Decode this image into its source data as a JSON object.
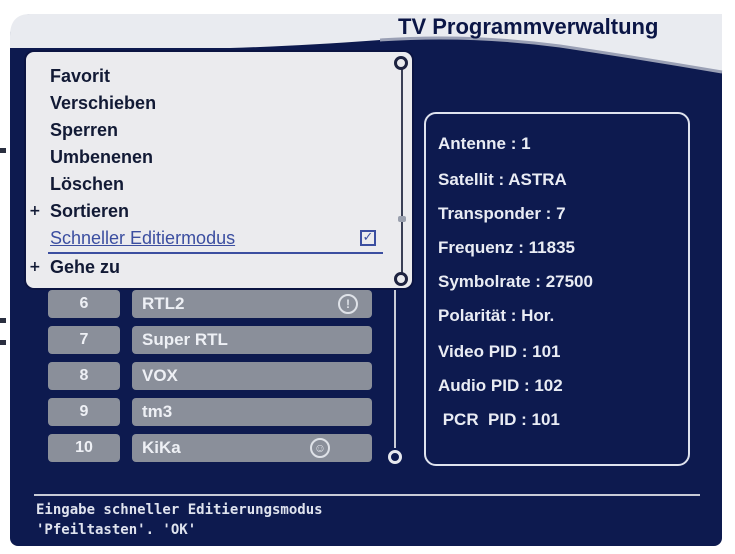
{
  "header": {
    "title": "TV Programmverwaltung"
  },
  "menu": {
    "items": [
      {
        "label": "Favorit",
        "plus": ""
      },
      {
        "label": "Verschieben",
        "plus": ""
      },
      {
        "label": "Sperren",
        "plus": ""
      },
      {
        "label": "Umbenenen",
        "plus": ""
      },
      {
        "label": "Löschen",
        "plus": ""
      },
      {
        "label": "Sortieren",
        "plus": "+"
      },
      {
        "label": "Schneller Editiermodus",
        "plus": "",
        "checked": true,
        "selected": true
      },
      {
        "label": "Gehe zu",
        "plus": "+"
      }
    ],
    "check_glyph": "✓"
  },
  "channels": [
    {
      "num": "6",
      "name": "RTL2",
      "badge": "!"
    },
    {
      "num": "7",
      "name": "Super RTL",
      "badge": ""
    },
    {
      "num": "8",
      "name": "VOX",
      "badge": ""
    },
    {
      "num": "9",
      "name": "tm3",
      "badge": ""
    },
    {
      "num": "10",
      "name": "KiKa",
      "badge": "☺"
    }
  ],
  "info": [
    "Antenne : 1",
    "Satellit : ASTRA",
    "Transponder : 7",
    "Frequenz : 11835",
    "Symbolrate : 27500",
    "Polarität : Hor.",
    "Video PID : 101",
    "Audio PID : 102",
    " PCR  PID : 101"
  ],
  "status": {
    "line1": "Eingabe schneller Editierungsmodus",
    "line2": "'Pfeiltasten'. 'OK'"
  },
  "colors": {
    "panel": "#0d1a4f",
    "menu_bg": "#ebebee",
    "selected_text": "#3b4ea0",
    "channel_bg": "#8a8f9a"
  }
}
